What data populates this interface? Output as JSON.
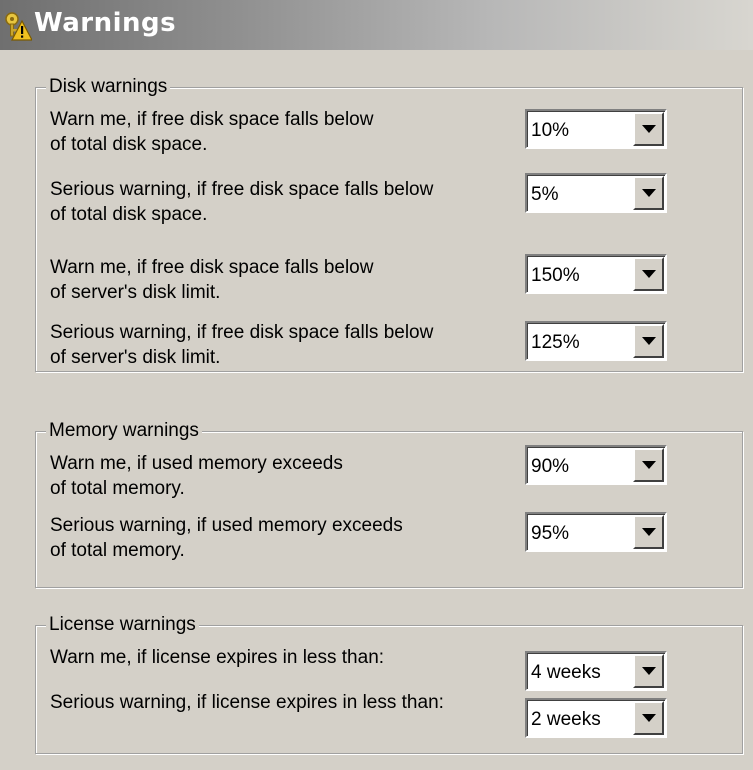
{
  "header": {
    "title": "Warnings",
    "icon": "warning-key-icon"
  },
  "disk": {
    "legend": "Disk warnings",
    "rows": [
      {
        "label_line1": "Warn me, if free disk space falls below",
        "label_line2": "of total disk space.",
        "value": "10%"
      },
      {
        "label_line1": "Serious warning, if free disk space falls below",
        "label_line2": "of total disk space.",
        "value": "5%"
      },
      {
        "label_line1": "Warn me, if free disk space falls below",
        "label_line2": "of server's disk limit.",
        "value": "150%"
      },
      {
        "label_line1": "Serious warning, if free disk space falls below",
        "label_line2": "of server's disk limit.",
        "value": "125%"
      }
    ]
  },
  "memory": {
    "legend": "Memory warnings",
    "rows": [
      {
        "label_line1": "Warn me, if used memory exceeds",
        "label_line2": "of total memory.",
        "value": "90%"
      },
      {
        "label_line1": "Serious warning, if used memory exceeds",
        "label_line2": "of total memory.",
        "value": "95%"
      }
    ]
  },
  "license": {
    "legend": "License warnings",
    "rows": [
      {
        "label": "Warn me, if license expires in less than:",
        "value": "4 weeks"
      },
      {
        "label": "Serious warning, if license expires in less than:",
        "value": "2 weeks"
      }
    ]
  }
}
